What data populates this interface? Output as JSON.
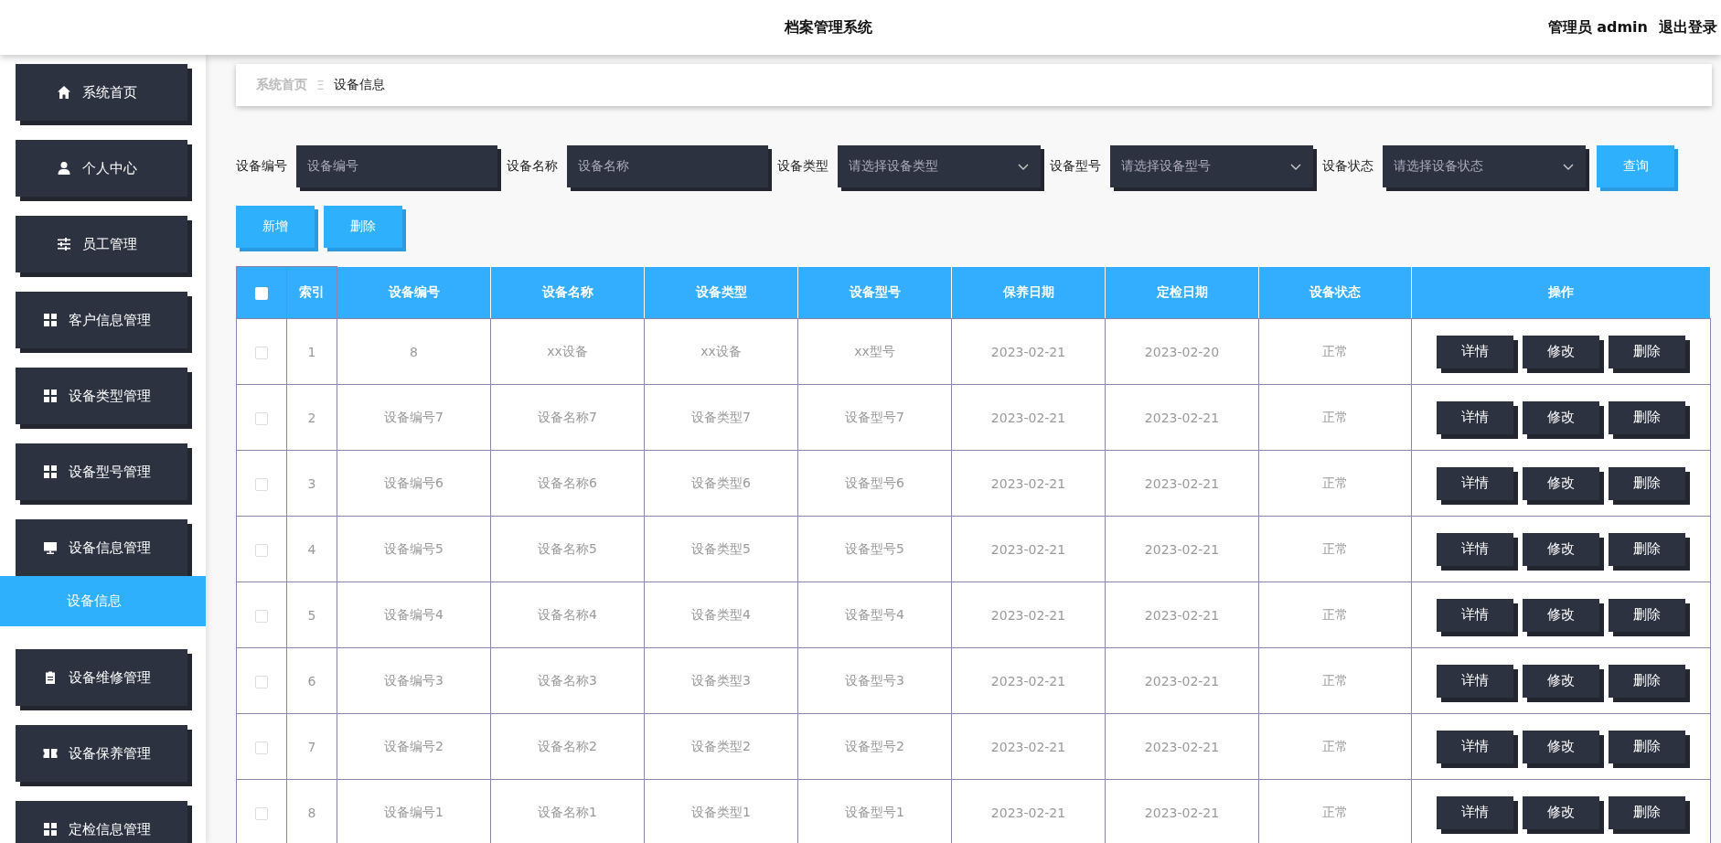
{
  "header": {
    "title": "档案管理系统",
    "user": "管理员 admin",
    "logout": "退出登录"
  },
  "sidebar": {
    "items": [
      {
        "label": "系统首页",
        "selected": false
      },
      {
        "label": "个人中心",
        "selected": false
      },
      {
        "label": "员工管理",
        "selected": false
      },
      {
        "label": "客户信息管理",
        "selected": false
      },
      {
        "label": "设备类型管理",
        "selected": false
      },
      {
        "label": "设备型号管理",
        "selected": false
      },
      {
        "label": "设备信息管理",
        "selected": false,
        "expanded": true,
        "children": [
          {
            "label": "设备信息",
            "selected": true
          }
        ]
      },
      {
        "label": "设备维修管理",
        "selected": false
      },
      {
        "label": "设备保养管理",
        "selected": false
      },
      {
        "label": "定检信息管理",
        "selected": false
      }
    ]
  },
  "breadcrumb": {
    "items": [
      "系统首页",
      "设备信息"
    ],
    "separator": "Ξ"
  },
  "search": {
    "fields": [
      {
        "kind": "input",
        "label": "设备编号",
        "placeholder": "设备编号"
      },
      {
        "kind": "input",
        "label": "设备名称",
        "placeholder": "设备名称"
      },
      {
        "kind": "select",
        "label": "设备类型",
        "placeholder": "请选择设备类型"
      },
      {
        "kind": "select",
        "label": "设备型号",
        "placeholder": "请选择设备型号"
      },
      {
        "kind": "select",
        "label": "设备状态",
        "placeholder": "请选择设备状态"
      }
    ],
    "button": "查询"
  },
  "actions": [
    "新增",
    "删除"
  ],
  "table": {
    "select_all_checked": false,
    "columns": [
      "索引",
      "设备编号",
      "设备名称",
      "设备类型",
      "设备型号",
      "保养日期",
      "定检日期",
      "设备状态",
      "操作"
    ],
    "rows": [
      {
        "checked": false,
        "cells": [
          "1",
          "8",
          "xx设备",
          "xx设备",
          "xx型号",
          "2023-02-21",
          "2023-02-20",
          "正常"
        ],
        "actions": [
          "详情",
          "修改",
          "删除"
        ]
      },
      {
        "checked": false,
        "cells": [
          "2",
          "设备编号7",
          "设备名称7",
          "设备类型7",
          "设备型号7",
          "2023-02-21",
          "2023-02-21",
          "正常"
        ],
        "actions": [
          "详情",
          "修改",
          "删除"
        ]
      },
      {
        "checked": false,
        "cells": [
          "3",
          "设备编号6",
          "设备名称6",
          "设备类型6",
          "设备型号6",
          "2023-02-21",
          "2023-02-21",
          "正常"
        ],
        "actions": [
          "详情",
          "修改",
          "删除"
        ]
      },
      {
        "checked": false,
        "cells": [
          "4",
          "设备编号5",
          "设备名称5",
          "设备类型5",
          "设备型号5",
          "2023-02-21",
          "2023-02-21",
          "正常"
        ],
        "actions": [
          "详情",
          "修改",
          "删除"
        ]
      },
      {
        "checked": false,
        "cells": [
          "5",
          "设备编号4",
          "设备名称4",
          "设备类型4",
          "设备型号4",
          "2023-02-21",
          "2023-02-21",
          "正常"
        ],
        "actions": [
          "详情",
          "修改",
          "删除"
        ]
      },
      {
        "checked": false,
        "cells": [
          "6",
          "设备编号3",
          "设备名称3",
          "设备类型3",
          "设备型号3",
          "2023-02-21",
          "2023-02-21",
          "正常"
        ],
        "actions": [
          "详情",
          "修改",
          "删除"
        ]
      },
      {
        "checked": false,
        "cells": [
          "7",
          "设备编号2",
          "设备名称2",
          "设备类型2",
          "设备型号2",
          "2023-02-21",
          "2023-02-21",
          "正常"
        ],
        "actions": [
          "详情",
          "修改",
          "删除"
        ]
      },
      {
        "checked": false,
        "cells": [
          "8",
          "设备编号1",
          "设备名称1",
          "设备类型1",
          "设备型号1",
          "2023-02-21",
          "2023-02-21",
          "正常"
        ],
        "actions": [
          "详情",
          "修改",
          "删除"
        ]
      }
    ]
  }
}
